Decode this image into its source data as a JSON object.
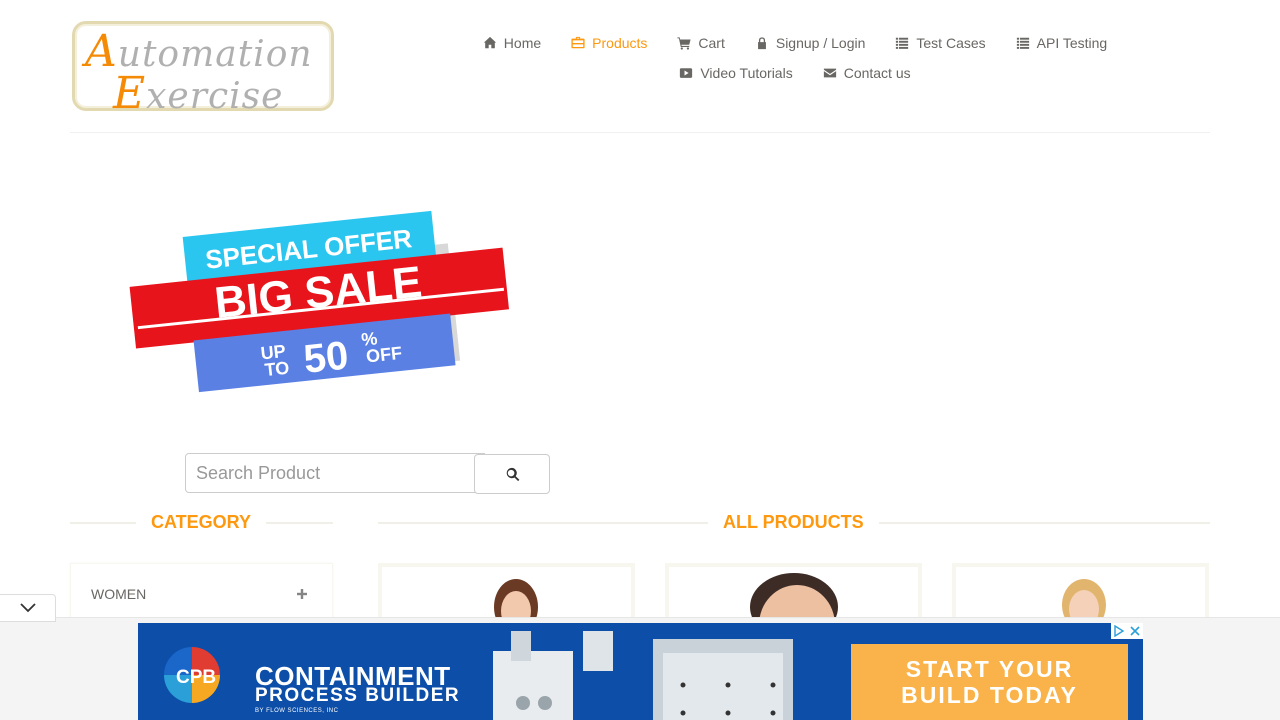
{
  "header": {
    "logo": {
      "line1": "utomation",
      "line1_cap": "A",
      "line2": "xercise",
      "line2_cap": "E"
    },
    "nav": [
      {
        "label": "Home",
        "icon": "home-icon",
        "active": false
      },
      {
        "label": "Products",
        "icon": "briefcase-icon",
        "active": true
      },
      {
        "label": "Cart",
        "icon": "cart-icon",
        "active": false
      },
      {
        "label": "Signup / Login",
        "icon": "lock-icon",
        "active": false
      },
      {
        "label": "Test Cases",
        "icon": "list-icon",
        "active": false
      },
      {
        "label": "API Testing",
        "icon": "list-icon",
        "active": false
      },
      {
        "label": "Video Tutorials",
        "icon": "youtube-icon",
        "active": false
      },
      {
        "label": "Contact us",
        "icon": "envelope-icon",
        "active": false
      }
    ]
  },
  "banner": {
    "line1": "SPECIAL OFFER",
    "line2": "BIG SALE",
    "line3_prefix_top": "UP",
    "line3_prefix_bottom": "TO",
    "line3_number": "50",
    "line3_pct": "%",
    "line3_suffix": "OFF"
  },
  "search": {
    "placeholder": "Search Product",
    "button_icon": "search-icon"
  },
  "sidebar": {
    "title": "Category",
    "items": [
      {
        "label": "WOMEN",
        "icon": "plus-icon"
      }
    ]
  },
  "products": {
    "title": "All Products"
  },
  "ad": {
    "logo_text": "CPB",
    "line1": "CONTAINMENT",
    "line2": "PROCESS BUILDER",
    "line3": "BY FLOW SCIENCES, INC",
    "cta_line1": "START YOUR",
    "cta_line2": "BUILD TODAY"
  },
  "colors": {
    "accent": "#fe980f",
    "text": "#696763",
    "ad_blue": "#0c4ea8",
    "ad_cta": "#f9b34a"
  }
}
